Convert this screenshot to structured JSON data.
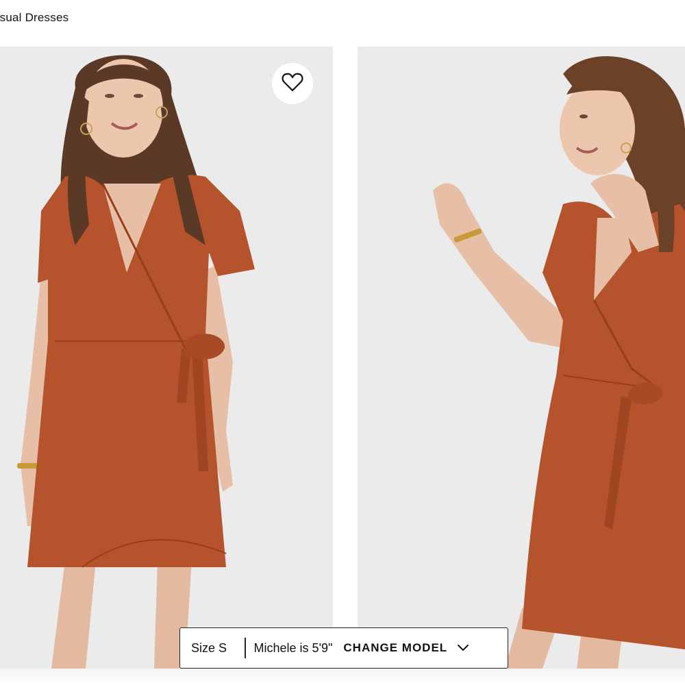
{
  "breadcrumb": {
    "text": "asual Dresses"
  },
  "gallery": {
    "images": [
      {
        "name": "model-front-view",
        "dress_color": "#b5532c",
        "background": "#ebebec"
      },
      {
        "name": "model-side-view",
        "dress_color": "#b5532c",
        "background": "#ebebec"
      }
    ],
    "favorite_icon": "heart-outline-icon"
  },
  "model_bar": {
    "size_label": "Size S",
    "model_info": "Michele is 5'9\"",
    "change_model_label": "CHANGE MODEL",
    "chevron_icon": "chevron-down-icon"
  },
  "colors": {
    "dress": "#b5532c",
    "photo_background": "#ebebec",
    "text": "#111111"
  }
}
